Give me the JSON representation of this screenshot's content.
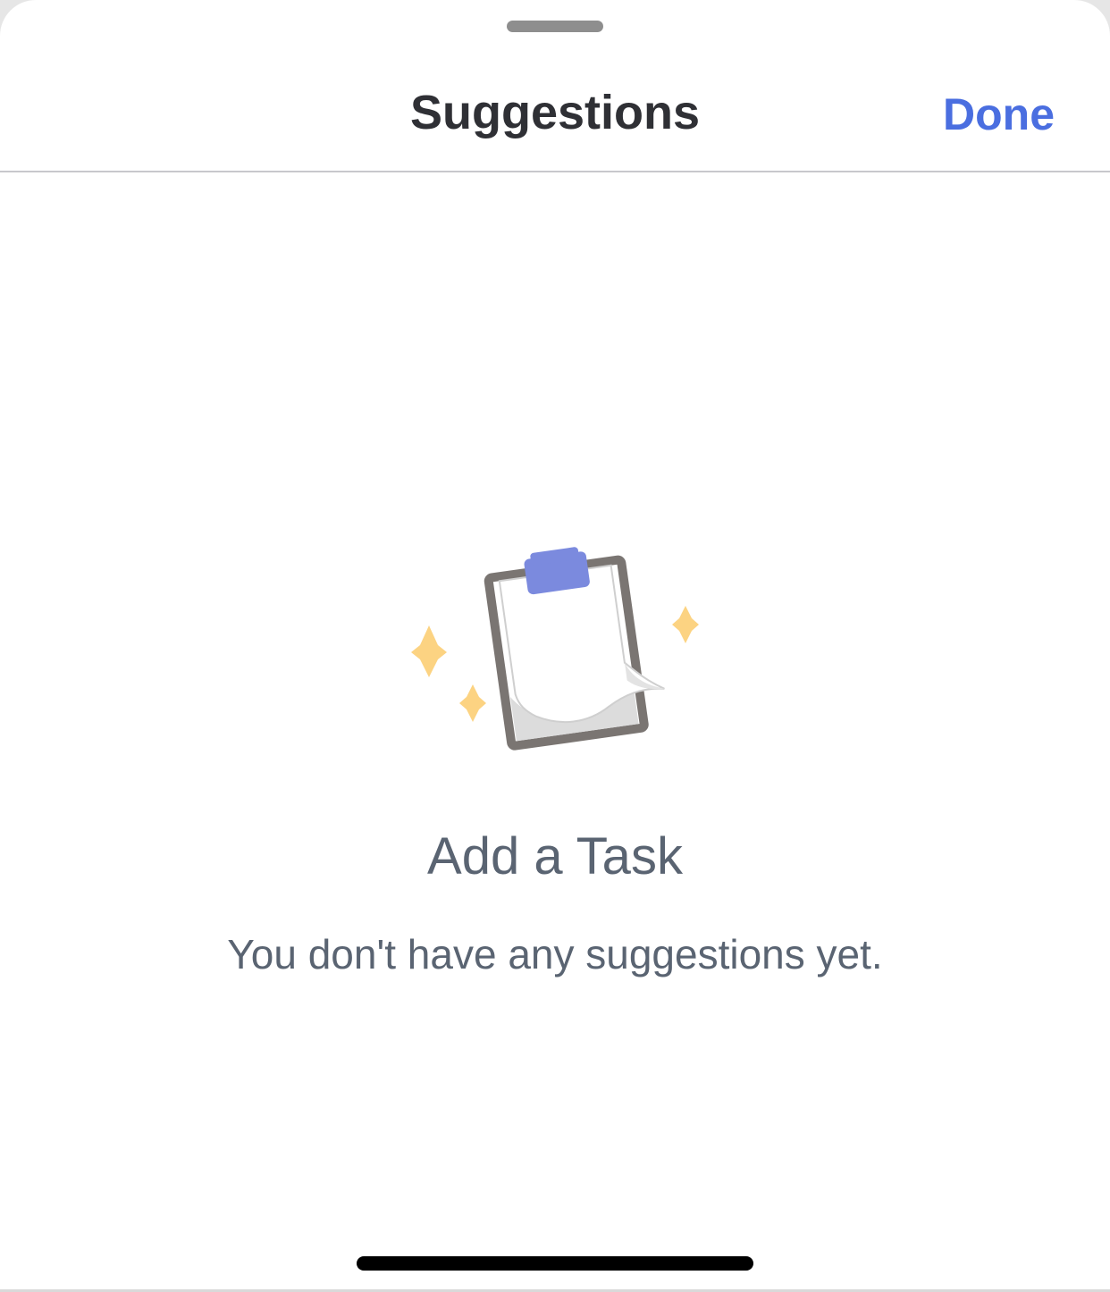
{
  "header": {
    "title": "Suggestions",
    "done_label": "Done"
  },
  "empty_state": {
    "title": "Add a Task",
    "message": "You don't have any suggestions yet.",
    "illustration": "clipboard-with-sparkles"
  },
  "colors": {
    "accent": "#4a6ee0",
    "title_text": "#2f3035",
    "body_text": "#5a6472",
    "clip": "#7b8ade",
    "sparkle": "#fcd382",
    "board_frame": "#7a7572"
  }
}
